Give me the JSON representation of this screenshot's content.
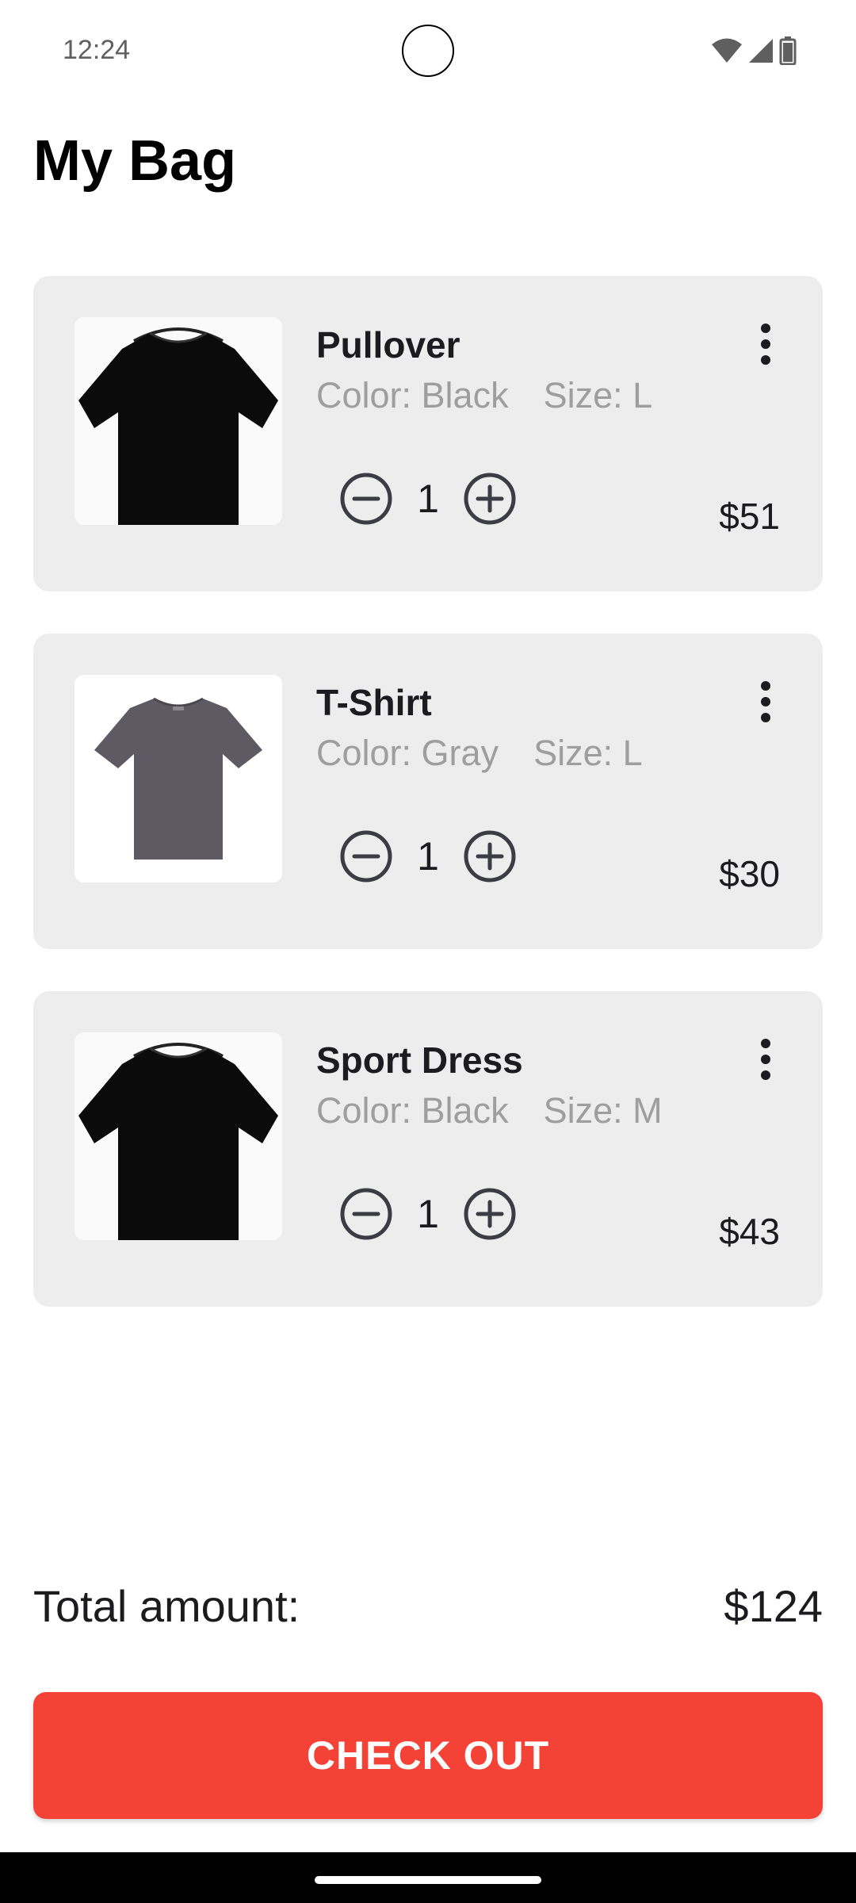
{
  "status_bar": {
    "time": "12:24",
    "icons": [
      "wifi-icon",
      "cellular-signal-icon",
      "battery-icon"
    ]
  },
  "page": {
    "title": "My Bag"
  },
  "cart": {
    "items": [
      {
        "name": "Pullover",
        "color": "Color: Black",
        "size": "Size: L",
        "quantity": "1",
        "price": "$51",
        "image": "black-tshirt-image"
      },
      {
        "name": "T-Shirt",
        "color": "Color: Gray",
        "size": "Size: L",
        "quantity": "1",
        "price": "$30",
        "image": "gray-tshirt-image"
      },
      {
        "name": "Sport Dress",
        "color": "Color: Black",
        "size": "Size: M",
        "quantity": "1",
        "price": "$43",
        "image": "black-tshirt-image"
      }
    ]
  },
  "summary": {
    "total_label": "Total amount:",
    "total_value": "$124"
  },
  "actions": {
    "checkout_label": "CHECK OUT"
  },
  "colors": {
    "accent": "#f44336",
    "card_background": "#ededed",
    "secondary_text": "#9e9e9e",
    "primary_text": "#1c1b1f"
  }
}
